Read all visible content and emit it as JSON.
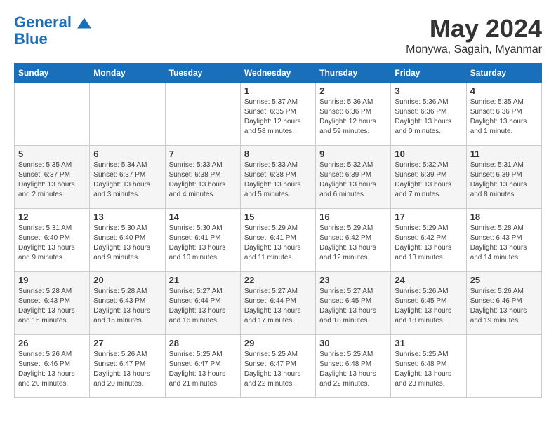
{
  "header": {
    "logo_line1": "General",
    "logo_line2": "Blue",
    "month_title": "May 2024",
    "location": "Monywa, Sagain, Myanmar"
  },
  "weekdays": [
    "Sunday",
    "Monday",
    "Tuesday",
    "Wednesday",
    "Thursday",
    "Friday",
    "Saturday"
  ],
  "weeks": [
    [
      {
        "day": "",
        "info": ""
      },
      {
        "day": "",
        "info": ""
      },
      {
        "day": "",
        "info": ""
      },
      {
        "day": "1",
        "info": "Sunrise: 5:37 AM\nSunset: 6:35 PM\nDaylight: 12 hours\nand 58 minutes."
      },
      {
        "day": "2",
        "info": "Sunrise: 5:36 AM\nSunset: 6:36 PM\nDaylight: 12 hours\nand 59 minutes."
      },
      {
        "day": "3",
        "info": "Sunrise: 5:36 AM\nSunset: 6:36 PM\nDaylight: 13 hours\nand 0 minutes."
      },
      {
        "day": "4",
        "info": "Sunrise: 5:35 AM\nSunset: 6:36 PM\nDaylight: 13 hours\nand 1 minute."
      }
    ],
    [
      {
        "day": "5",
        "info": "Sunrise: 5:35 AM\nSunset: 6:37 PM\nDaylight: 13 hours\nand 2 minutes."
      },
      {
        "day": "6",
        "info": "Sunrise: 5:34 AM\nSunset: 6:37 PM\nDaylight: 13 hours\nand 3 minutes."
      },
      {
        "day": "7",
        "info": "Sunrise: 5:33 AM\nSunset: 6:38 PM\nDaylight: 13 hours\nand 4 minutes."
      },
      {
        "day": "8",
        "info": "Sunrise: 5:33 AM\nSunset: 6:38 PM\nDaylight: 13 hours\nand 5 minutes."
      },
      {
        "day": "9",
        "info": "Sunrise: 5:32 AM\nSunset: 6:39 PM\nDaylight: 13 hours\nand 6 minutes."
      },
      {
        "day": "10",
        "info": "Sunrise: 5:32 AM\nSunset: 6:39 PM\nDaylight: 13 hours\nand 7 minutes."
      },
      {
        "day": "11",
        "info": "Sunrise: 5:31 AM\nSunset: 6:39 PM\nDaylight: 13 hours\nand 8 minutes."
      }
    ],
    [
      {
        "day": "12",
        "info": "Sunrise: 5:31 AM\nSunset: 6:40 PM\nDaylight: 13 hours\nand 9 minutes."
      },
      {
        "day": "13",
        "info": "Sunrise: 5:30 AM\nSunset: 6:40 PM\nDaylight: 13 hours\nand 9 minutes."
      },
      {
        "day": "14",
        "info": "Sunrise: 5:30 AM\nSunset: 6:41 PM\nDaylight: 13 hours\nand 10 minutes."
      },
      {
        "day": "15",
        "info": "Sunrise: 5:29 AM\nSunset: 6:41 PM\nDaylight: 13 hours\nand 11 minutes."
      },
      {
        "day": "16",
        "info": "Sunrise: 5:29 AM\nSunset: 6:42 PM\nDaylight: 13 hours\nand 12 minutes."
      },
      {
        "day": "17",
        "info": "Sunrise: 5:29 AM\nSunset: 6:42 PM\nDaylight: 13 hours\nand 13 minutes."
      },
      {
        "day": "18",
        "info": "Sunrise: 5:28 AM\nSunset: 6:43 PM\nDaylight: 13 hours\nand 14 minutes."
      }
    ],
    [
      {
        "day": "19",
        "info": "Sunrise: 5:28 AM\nSunset: 6:43 PM\nDaylight: 13 hours\nand 15 minutes."
      },
      {
        "day": "20",
        "info": "Sunrise: 5:28 AM\nSunset: 6:43 PM\nDaylight: 13 hours\nand 15 minutes."
      },
      {
        "day": "21",
        "info": "Sunrise: 5:27 AM\nSunset: 6:44 PM\nDaylight: 13 hours\nand 16 minutes."
      },
      {
        "day": "22",
        "info": "Sunrise: 5:27 AM\nSunset: 6:44 PM\nDaylight: 13 hours\nand 17 minutes."
      },
      {
        "day": "23",
        "info": "Sunrise: 5:27 AM\nSunset: 6:45 PM\nDaylight: 13 hours\nand 18 minutes."
      },
      {
        "day": "24",
        "info": "Sunrise: 5:26 AM\nSunset: 6:45 PM\nDaylight: 13 hours\nand 18 minutes."
      },
      {
        "day": "25",
        "info": "Sunrise: 5:26 AM\nSunset: 6:46 PM\nDaylight: 13 hours\nand 19 minutes."
      }
    ],
    [
      {
        "day": "26",
        "info": "Sunrise: 5:26 AM\nSunset: 6:46 PM\nDaylight: 13 hours\nand 20 minutes."
      },
      {
        "day": "27",
        "info": "Sunrise: 5:26 AM\nSunset: 6:47 PM\nDaylight: 13 hours\nand 20 minutes."
      },
      {
        "day": "28",
        "info": "Sunrise: 5:25 AM\nSunset: 6:47 PM\nDaylight: 13 hours\nand 21 minutes."
      },
      {
        "day": "29",
        "info": "Sunrise: 5:25 AM\nSunset: 6:47 PM\nDaylight: 13 hours\nand 22 minutes."
      },
      {
        "day": "30",
        "info": "Sunrise: 5:25 AM\nSunset: 6:48 PM\nDaylight: 13 hours\nand 22 minutes."
      },
      {
        "day": "31",
        "info": "Sunrise: 5:25 AM\nSunset: 6:48 PM\nDaylight: 13 hours\nand 23 minutes."
      },
      {
        "day": "",
        "info": ""
      }
    ]
  ]
}
